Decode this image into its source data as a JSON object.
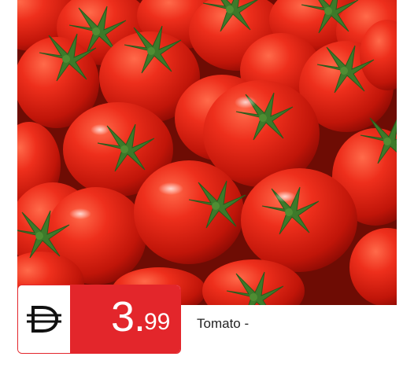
{
  "offer": {
    "currency_icon": "dirham-icon",
    "price_integer": "3.",
    "price_fraction": "99",
    "product_name": "Tomato -"
  },
  "colors": {
    "accent": "#e3262b",
    "tomato": "#e1261a",
    "stem": "#3d7a2a"
  },
  "photo": {
    "subject": "tomato-icon"
  }
}
